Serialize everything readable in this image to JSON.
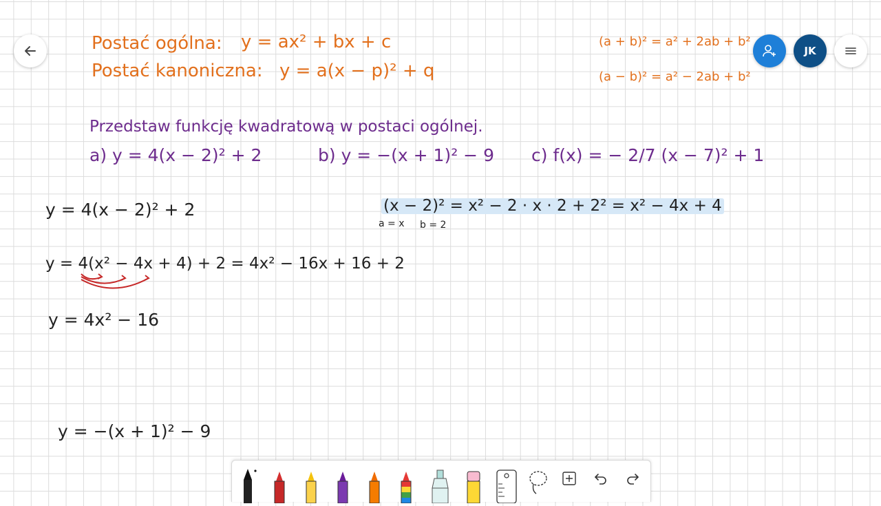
{
  "note": {
    "ogolna_label": "Postać ogólna:",
    "ogolna_formula": "y = ax² + bx + c",
    "kanoniczna_label": "Postać kanoniczna:",
    "kanoniczna_formula": "y = a(x − p)² + q",
    "identity_plus": "(a + b)² = a² + 2ab + b²",
    "identity_minus": "(a − b)² = a² − 2ab + b²",
    "task": "Przedstaw funkcję kwadratową w postaci ogólnej.",
    "task_a": "a)  y = 4(x − 2)² + 2",
    "task_b": "b)  y = −(x + 1)² − 9",
    "task_c": "c)  f(x) = − 2/7 (x − 7)² + 1",
    "work_1": "y = 4(x − 2)² + 2",
    "work_side": "(x − 2)² = x² − 2 · x · 2 + 2² = x² − 4x + 4",
    "work_side_sub_a": "a = x",
    "work_side_sub_b": "b = 2",
    "work_2": "y = 4(x² − 4x + 4) + 2 = 4x² − 16x + 16 + 2",
    "work_3": "y = 4x² − 16",
    "work_4": "y = −(x + 1)² − 9"
  },
  "header": {
    "back_icon": "arrow-left-icon",
    "invite_icon": "add-person-icon",
    "avatar_initials": "JK",
    "menu_icon": "hamburger-menu-icon"
  },
  "colors": {
    "orange_ink": "#e2701d",
    "purple_ink": "#6d2c8d",
    "black_ink": "#222222",
    "highlight": "#d6e8f7",
    "accent_blue": "#1e7fd8",
    "avatar_blue": "#0e4f86"
  },
  "toolbar": {
    "tools": [
      "pen-black",
      "pen-red",
      "pen-yellow",
      "pen-purple",
      "pen-orange",
      "pen-rainbow",
      "highlighter-teal",
      "eraser-pink",
      "ruler",
      "lasso",
      "add-space",
      "undo",
      "redo"
    ]
  }
}
